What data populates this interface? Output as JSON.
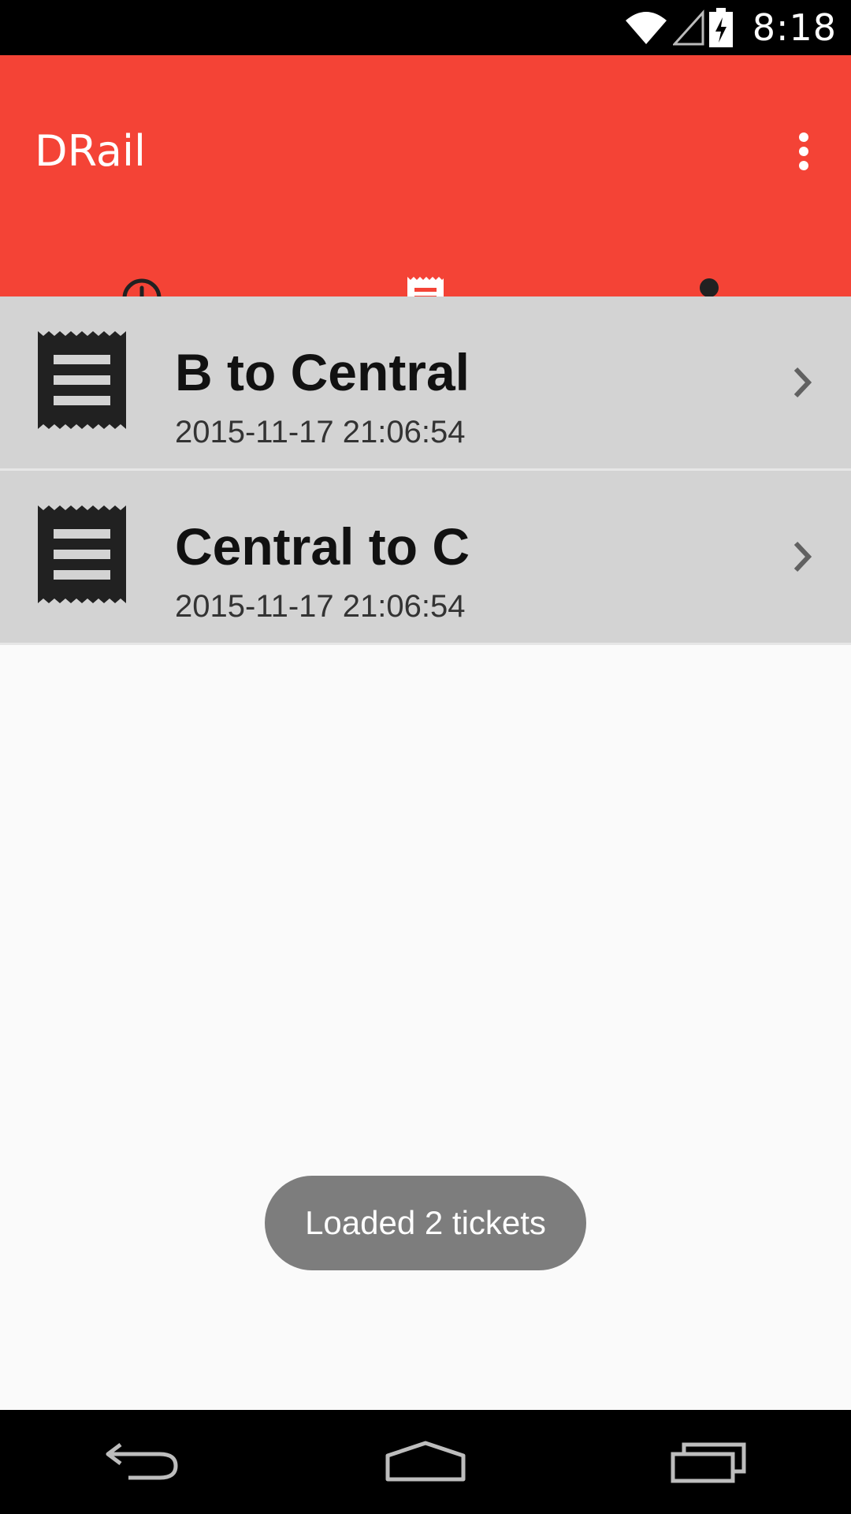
{
  "status_bar": {
    "time": "8:18",
    "icons": [
      "wifi-icon",
      "cell-signal-icon",
      "battery-charging-icon"
    ]
  },
  "app_bar": {
    "title": "DRail",
    "menu_icon": "more-vert-icon",
    "color": "#f44336"
  },
  "tabs": [
    {
      "icon": "clock-icon",
      "selected": false
    },
    {
      "icon": "receipt-icon",
      "selected": true
    },
    {
      "icon": "person-icon",
      "selected": false
    }
  ],
  "tickets": [
    {
      "route": "B to Central",
      "timestamp": "2015-11-17 21:06:54",
      "icon": "receipt-icon"
    },
    {
      "route": "Central to C",
      "timestamp": "2015-11-17 21:06:54",
      "icon": "receipt-icon"
    }
  ],
  "toast": {
    "message": "Loaded 2 tickets"
  },
  "nav_bar": {
    "buttons": [
      "back-icon",
      "home-icon",
      "recents-icon"
    ]
  }
}
